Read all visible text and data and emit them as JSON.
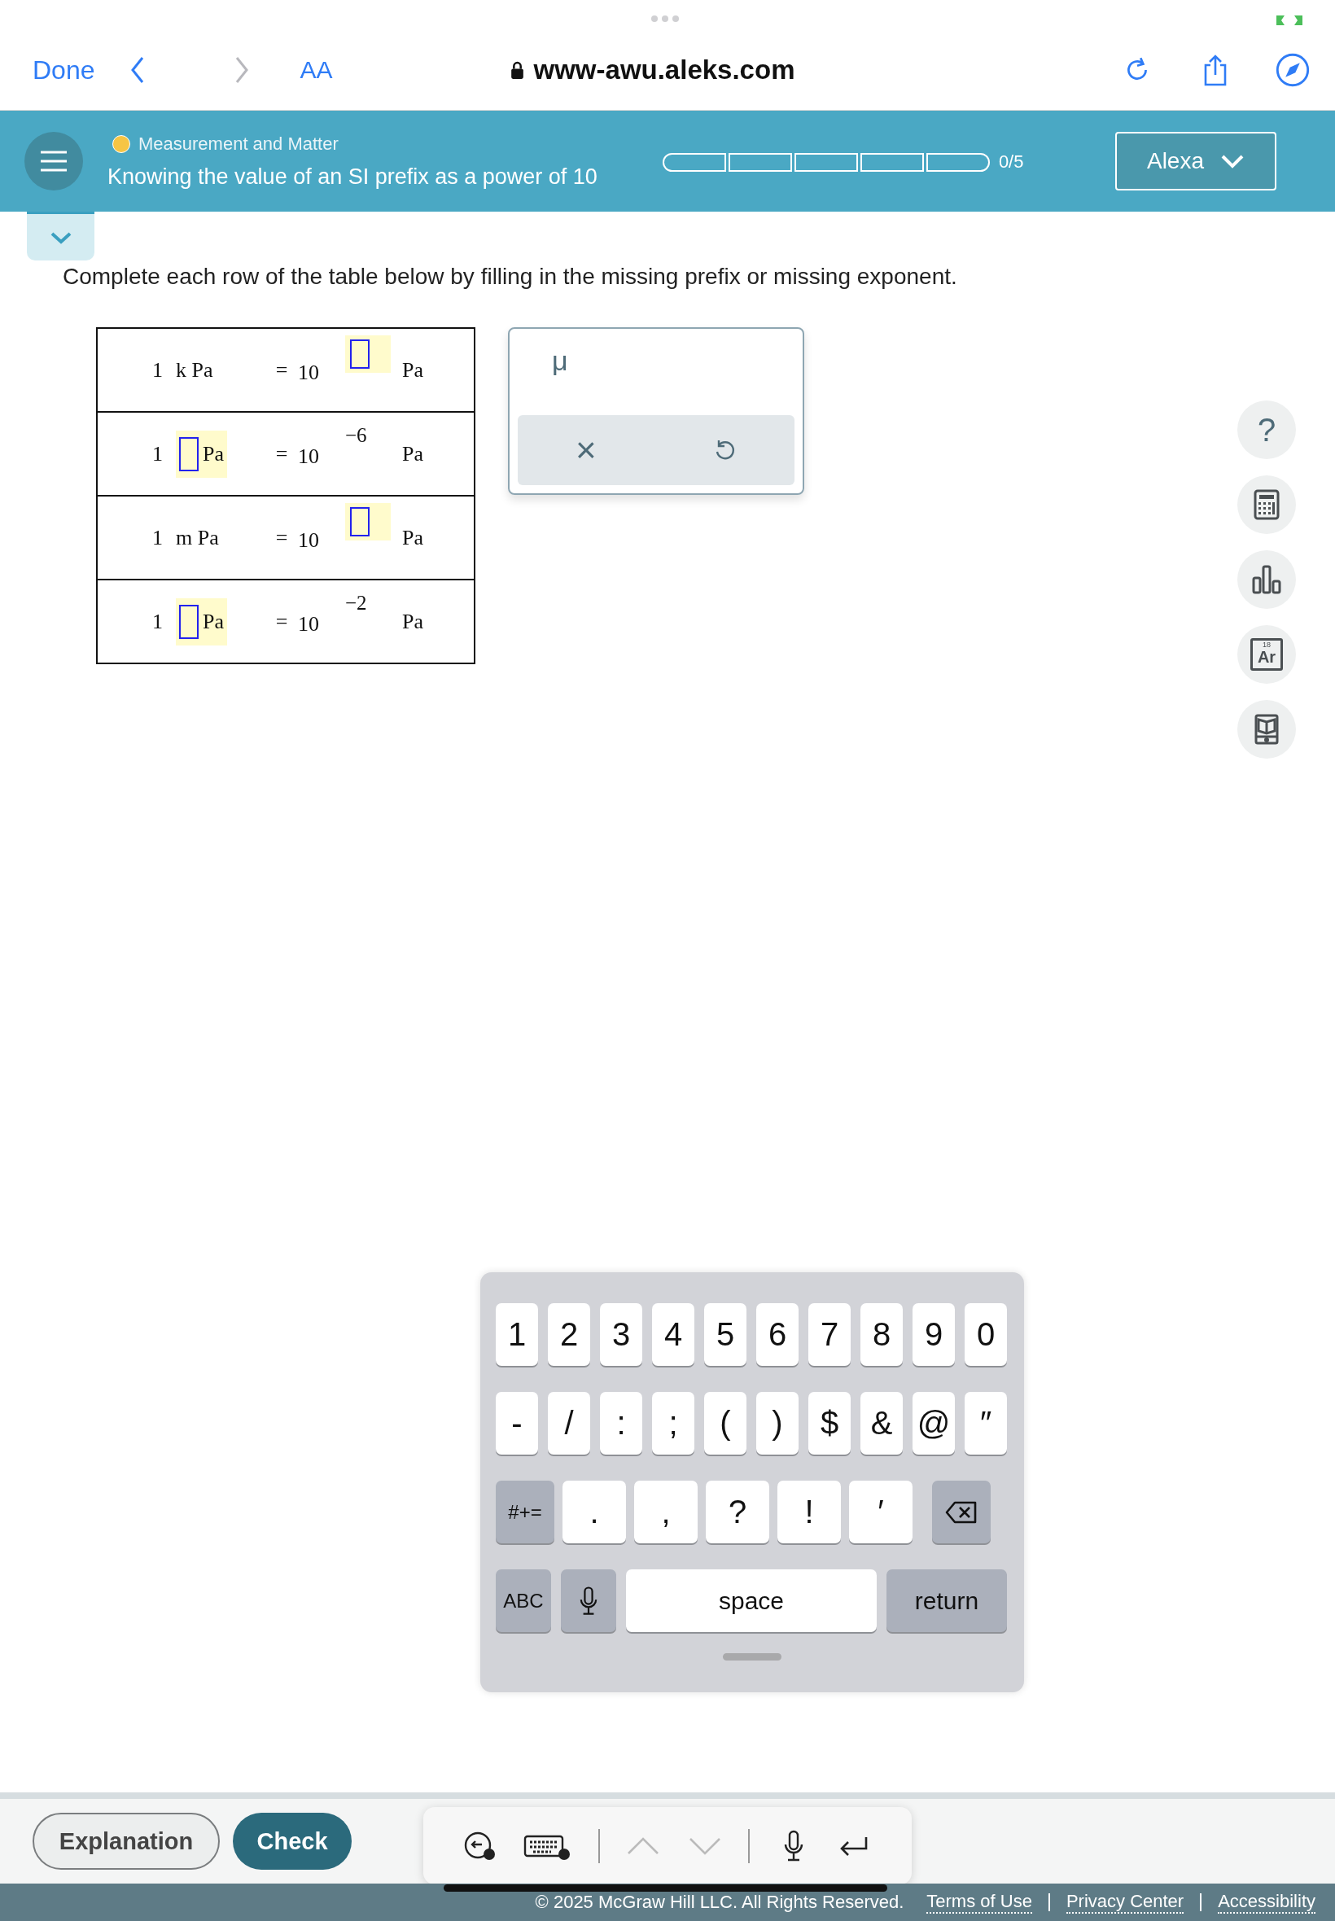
{
  "browser": {
    "done": "Done",
    "text_size": "AA",
    "url": "www-awu.aleks.com"
  },
  "header": {
    "topic": "Measurement and Matter",
    "title": "Knowing the value of an SI prefix as a power of 10",
    "progress": [
      {
        "filled": false
      },
      {
        "filled": false
      },
      {
        "filled": false
      },
      {
        "filled": false
      },
      {
        "filled": false
      }
    ],
    "progress_text": "0/5",
    "user": "Alexa"
  },
  "instruction": "Complete each row of the table below by filling in the missing prefix or missing exponent.",
  "table": {
    "rows": [
      {
        "one": "1",
        "prefix": {
          "kind": "text",
          "text": "k"
        },
        "unit": "Pa",
        "equals": "=",
        "base": "10",
        "exponent": {
          "kind": "blank"
        },
        "unit_right": "Pa"
      },
      {
        "one": "1",
        "prefix": {
          "kind": "blank"
        },
        "unit": "Pa",
        "equals": "=",
        "base": "10",
        "exponent": {
          "kind": "text",
          "text": "−6"
        },
        "unit_right": "Pa"
      },
      {
        "one": "1",
        "prefix": {
          "kind": "text",
          "text": "m"
        },
        "unit": "Pa",
        "equals": "=",
        "base": "10",
        "exponent": {
          "kind": "blank"
        },
        "unit_right": "Pa"
      },
      {
        "one": "1",
        "prefix": {
          "kind": "blank"
        },
        "unit": "Pa",
        "equals": "=",
        "base": "10",
        "exponent": {
          "kind": "text",
          "text": "−2"
        },
        "unit_right": "Pa"
      }
    ]
  },
  "palette": {
    "symbol": "μ",
    "clear": "×"
  },
  "tools": [
    {
      "kind": "help",
      "text": "?"
    },
    {
      "kind": "calculator"
    },
    {
      "kind": "chart"
    },
    {
      "kind": "periodic",
      "number": "18",
      "symbol": "Ar"
    },
    {
      "kind": "book"
    }
  ],
  "keyboard": {
    "rows": [
      {
        "keys": [
          {
            "kind": "char",
            "text": "1"
          },
          {
            "kind": "char",
            "text": "2"
          },
          {
            "kind": "char",
            "text": "3"
          },
          {
            "kind": "char",
            "text": "4"
          },
          {
            "kind": "char",
            "text": "5"
          },
          {
            "kind": "char",
            "text": "6"
          },
          {
            "kind": "char",
            "text": "7"
          },
          {
            "kind": "char",
            "text": "8"
          },
          {
            "kind": "char",
            "text": "9"
          },
          {
            "kind": "char",
            "text": "0"
          }
        ]
      },
      {
        "keys": [
          {
            "kind": "char",
            "text": "-"
          },
          {
            "kind": "char",
            "text": "/"
          },
          {
            "kind": "char",
            "text": ":"
          },
          {
            "kind": "char",
            "text": ";"
          },
          {
            "kind": "char",
            "text": "("
          },
          {
            "kind": "char",
            "text": ")"
          },
          {
            "kind": "char",
            "text": "$"
          },
          {
            "kind": "char",
            "text": "&"
          },
          {
            "kind": "char",
            "text": "@"
          },
          {
            "kind": "char",
            "text": "″"
          }
        ]
      },
      {
        "keys": [
          {
            "kind": "mode",
            "text": "#+="
          },
          {
            "kind": "wide",
            "text": "."
          },
          {
            "kind": "wide",
            "text": ","
          },
          {
            "kind": "wide",
            "text": "?"
          },
          {
            "kind": "wide",
            "text": "!"
          },
          {
            "kind": "wide",
            "text": "′"
          },
          {
            "kind": "delete"
          }
        ]
      },
      {
        "keys": [
          {
            "kind": "mode",
            "text": "ABC"
          },
          {
            "kind": "mic"
          },
          {
            "kind": "space",
            "text": "space"
          },
          {
            "kind": "return",
            "text": "return"
          }
        ]
      }
    ]
  },
  "buttons": {
    "explanation": "Explanation",
    "check": "Check"
  },
  "footer": {
    "copyright": "© 2025 McGraw Hill LLC. All Rights Reserved.",
    "links": [
      "Terms of Use",
      "Privacy Center",
      "Accessibility"
    ]
  }
}
